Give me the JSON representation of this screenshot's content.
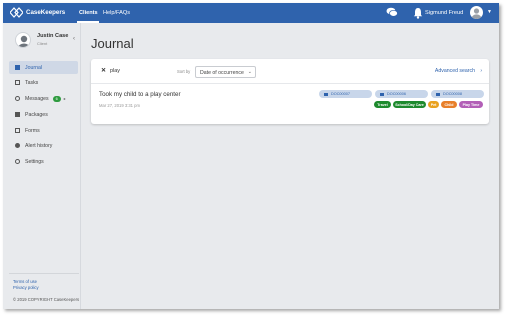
{
  "app": {
    "name": "CaseKeepers"
  },
  "nav": {
    "clients": "Clients",
    "help": "Help/FAQs"
  },
  "user": {
    "name": "Sigmund Freud"
  },
  "client": {
    "name": "Justin Case",
    "role": "Client"
  },
  "sidebar": {
    "items": [
      {
        "label": "Journal",
        "icon": "journal-icon"
      },
      {
        "label": "Tasks",
        "icon": "tasks-icon"
      },
      {
        "label": "Messages",
        "icon": "chat-icon",
        "badge": "6"
      },
      {
        "label": "Packages",
        "icon": "package-icon"
      },
      {
        "label": "Forms",
        "icon": "form-icon"
      },
      {
        "label": "Alert history",
        "icon": "alert-icon"
      },
      {
        "label": "Settings",
        "icon": "settings-icon"
      }
    ],
    "terms": "Terms of use",
    "privacy": "Privacy policy",
    "copyright": "© 2019 COPYRIGHT CaseKeepers"
  },
  "page": {
    "title": "Journal"
  },
  "search": {
    "value": "play",
    "sort_label": "Sort by",
    "sort_value": "Date of occurrence",
    "advanced": "Advanced search"
  },
  "entry": {
    "title": "Took my child to a play center",
    "date": "Mar 27, 2019 3:31 pm",
    "docs": [
      "DOC00007",
      "DOC00006",
      "DOC00008"
    ],
    "tags": [
      {
        "label": "Travel",
        "color": "#1e8a2e"
      },
      {
        "label": "School/Day Care",
        "color": "#1e8a2e"
      },
      {
        "label": "Pet",
        "color": "#e9a21f"
      },
      {
        "label": "Child",
        "color": "#e87f2a"
      },
      {
        "label": "Play Time",
        "color": "#b25fb7"
      }
    ]
  },
  "colors": {
    "brand": "#2f63ad",
    "badge": "#2e9b3f"
  }
}
